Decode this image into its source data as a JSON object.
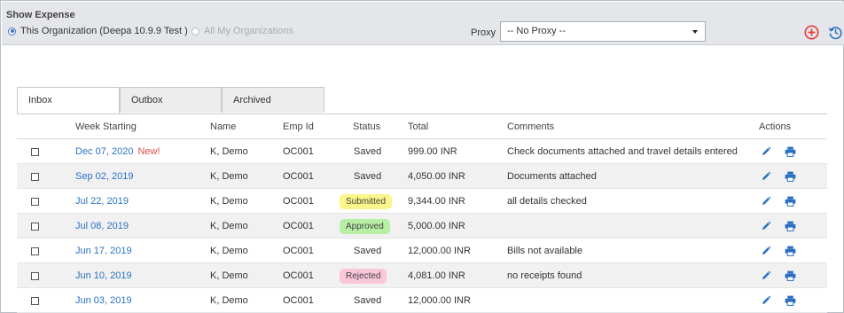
{
  "header": {
    "title": "Show Expense",
    "org_option": "This Organization (Deepa 10.9.9 Test )",
    "all_orgs_option": "All My Organizations",
    "proxy_label": "Proxy",
    "proxy_value": "-- No Proxy --"
  },
  "tabs": [
    {
      "label": "Inbox",
      "active": true
    },
    {
      "label": "Outbox",
      "active": false
    },
    {
      "label": "Archived",
      "active": false
    }
  ],
  "columns": {
    "week": "Week Starting",
    "name": "Name",
    "emp": "Emp Id",
    "status": "Status",
    "total": "Total",
    "comments": "Comments",
    "actions": "Actions"
  },
  "rows": [
    {
      "week": "Dec 07, 2020",
      "new": "New!",
      "name": "K, Demo",
      "emp": "OC001",
      "status": "Saved",
      "total": "999.00 INR",
      "comments": "Check documents attached and travel details entered"
    },
    {
      "week": "Sep 02, 2019",
      "new": "",
      "name": "K, Demo",
      "emp": "OC001",
      "status": "Saved",
      "total": "4,050.00 INR",
      "comments": "Documents attached"
    },
    {
      "week": "Jul 22, 2019",
      "new": "",
      "name": "K, Demo",
      "emp": "OC001",
      "status": "Submitted",
      "total": "9,344.00 INR",
      "comments": "all details checked"
    },
    {
      "week": "Jul 08, 2019",
      "new": "",
      "name": "K, Demo",
      "emp": "OC001",
      "status": "Approved",
      "total": "5,000.00 INR",
      "comments": ""
    },
    {
      "week": "Jun 17, 2019",
      "new": "",
      "name": "K, Demo",
      "emp": "OC001",
      "status": "Saved",
      "total": "12,000.00 INR",
      "comments": "Bills not available"
    },
    {
      "week": "Jun 10, 2019",
      "new": "",
      "name": "K, Demo",
      "emp": "OC001",
      "status": "Rejected",
      "total": "4,081.00 INR",
      "comments": "no receipts found"
    },
    {
      "week": "Jun 03, 2019",
      "new": "",
      "name": "K, Demo",
      "emp": "OC001",
      "status": "Saved",
      "total": "12,000.00 INR",
      "comments": ""
    }
  ],
  "colors": {
    "link": "#2a72c4",
    "new": "#e24c4c",
    "submitted_bg": "#fbf58a",
    "approved_bg": "#b7f0a5",
    "rejected_bg": "#f9c6da",
    "add_icon": "#e53b3b",
    "history_icon": "#2f72c0",
    "action_icon": "#2a6fc2"
  },
  "icons": {
    "add": "plus-circle-icon",
    "history": "history-icon",
    "edit": "pencil-icon",
    "print": "printer-icon"
  }
}
